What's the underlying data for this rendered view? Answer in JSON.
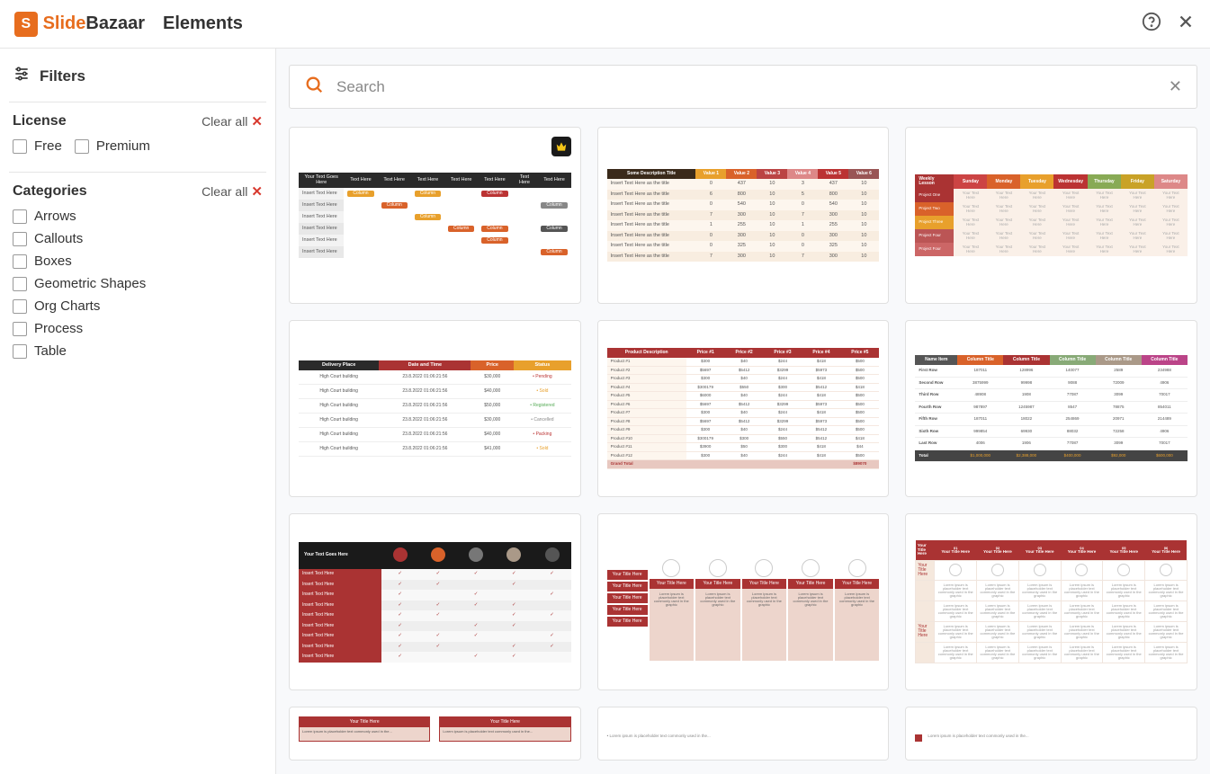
{
  "header": {
    "logo_text_1": "Slide",
    "logo_text_2": "Bazaar",
    "page_title": "Elements"
  },
  "search": {
    "placeholder": "Search"
  },
  "filters": {
    "title": "Filters",
    "license": {
      "title": "License",
      "clear_label": "Clear all",
      "options": [
        "Free",
        "Premium"
      ]
    },
    "categories": {
      "title": "Categories",
      "clear_label": "Clear all",
      "options": [
        "Arrows",
        "Callouts",
        "Boxes",
        "Geometric Shapes",
        "Org Charts",
        "Process",
        "Table"
      ]
    }
  },
  "templates": {
    "t1": {
      "header": [
        "Your Text Goes Here",
        "Text Here",
        "Text Here",
        "Text Here",
        "Text Here",
        "Text Here",
        "Text Here",
        "Text Here"
      ],
      "row_label": "Insert Text Here",
      "pill": "Column"
    },
    "t2": {
      "desc": "Some Description Title",
      "vals": [
        "Value 1",
        "Value 2",
        "Value 3",
        "Value 4",
        "Value 5",
        "Value 6"
      ],
      "row": "Insert Text Here as the title"
    },
    "t3": {
      "title": "Weekly Lesson",
      "days": [
        "Sunday",
        "Monday",
        "Tuesday",
        "Wednesday",
        "Thursday",
        "Friday",
        "Saturday"
      ],
      "projects": [
        "Project One",
        "Project Two",
        "Project Three",
        "Project Four",
        "Project Four"
      ],
      "cell": "Your Text Here"
    },
    "t4": {
      "headers": [
        "Delivery Place",
        "Date and Time",
        "Price",
        "Status"
      ],
      "place": "High Court building",
      "dt": "23.8.2022 01:06:21:56",
      "prices": [
        "$30,000",
        "$40,000",
        "$50,000",
        "$30,000",
        "$40,000",
        "$41,000"
      ],
      "statuses": [
        "Pending",
        "Sold",
        "Registered",
        "Cancelled",
        "Packing",
        "Sold"
      ]
    },
    "t5": {
      "headers": [
        "Product Description",
        "Price #1",
        "Price #2",
        "Price #3",
        "Price #4",
        "Price #5"
      ],
      "row": "Product #",
      "total": "Grand Total"
    },
    "t6": {
      "headers": [
        "Name Item",
        "Column Title",
        "Column Title",
        "Column Title",
        "Column Title",
        "Column Title"
      ],
      "rows": [
        "First Row",
        "Second Row",
        "Third Row",
        "Fourth Row",
        "Fifth Row",
        "Sixth Row",
        "Last Row"
      ],
      "total": "Total",
      "totals": [
        "$1,000,000",
        "$2,388,000",
        "$400,000",
        "$92,000",
        "$600,000"
      ]
    },
    "t7": {
      "title": "Your Text Goes Here",
      "row": "Insert Text Here"
    },
    "t8": {
      "tab": "Your Title Here",
      "lorem": "Lorem ipsum is placeholder text commonly used in the graphic"
    },
    "t9": {
      "title": "Your Title Here",
      "cols": [
        "01",
        "02",
        "03",
        "04",
        "05",
        "06"
      ],
      "sub": "Your Title Here"
    },
    "t10": {
      "title": "Your Title Here",
      "lorem": "Lorem ipsum is placeholder text commonly used in the..."
    }
  }
}
